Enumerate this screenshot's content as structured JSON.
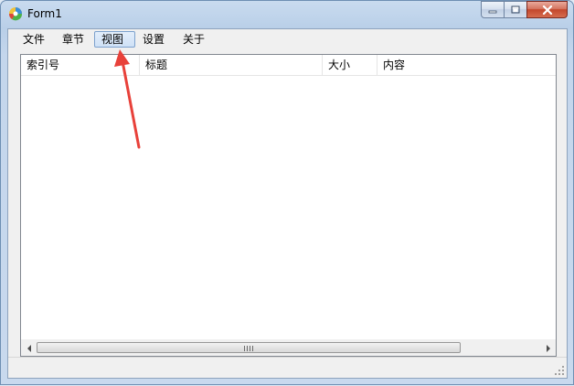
{
  "window": {
    "title": "Form1",
    "icon": "app-logo-icon",
    "controls": [
      "minimize-icon",
      "maximize-icon",
      "close-icon"
    ]
  },
  "menu": {
    "items": [
      {
        "label": "文件"
      },
      {
        "label": "章节"
      },
      {
        "label": "视图",
        "active": true
      },
      {
        "label": "设置"
      },
      {
        "label": "关于"
      }
    ]
  },
  "listview": {
    "columns": [
      {
        "label": "索引号"
      },
      {
        "label": "标题"
      },
      {
        "label": "大小"
      },
      {
        "label": "内容"
      }
    ],
    "rows": []
  },
  "annotation": {
    "arrow_color": "#e8413a",
    "points_to": "视图"
  },
  "colors": {
    "menu_active_border": "#7da2ce",
    "close_button": "#c3472c"
  }
}
